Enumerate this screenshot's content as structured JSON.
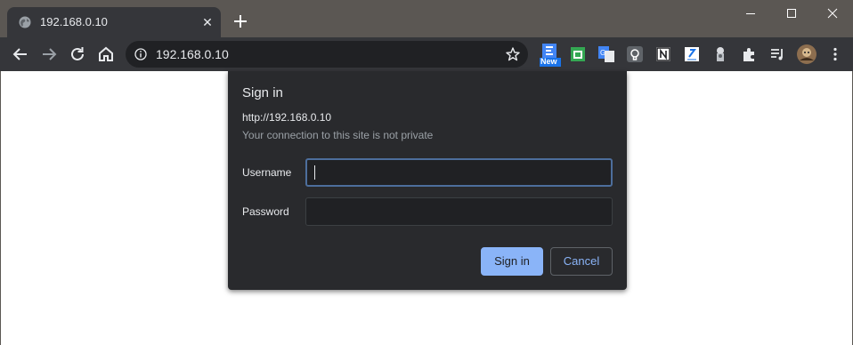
{
  "tab": {
    "title": "192.168.0.10",
    "favicon": "globe-icon",
    "close_glyph": "✕"
  },
  "window": {
    "controls": [
      "minimize-icon",
      "maximize-icon",
      "close-icon"
    ]
  },
  "toolbar": {
    "nav": [
      "back-icon",
      "forward-icon",
      "reload-icon",
      "home-icon"
    ],
    "address": "192.168.0.10",
    "extensions": [
      {
        "name": "new-extension-icon",
        "badge": "New"
      },
      {
        "name": "android-extension-icon"
      },
      {
        "name": "google-translate-icon"
      },
      {
        "name": "lightbulb-extension-icon"
      },
      {
        "name": "notion-icon"
      },
      {
        "name": "document-extension-icon"
      },
      {
        "name": "chef-extension-icon"
      },
      {
        "name": "puzzle-extensions-icon"
      },
      {
        "name": "media-queue-icon"
      },
      {
        "name": "profile-avatar"
      },
      {
        "name": "menu-kebab-icon"
      }
    ]
  },
  "dialog": {
    "title": "Sign in",
    "origin": "http://192.168.0.10",
    "warning": "Your connection to this site is not private",
    "username_label": "Username",
    "username_value": "",
    "password_label": "Password",
    "password_value": "",
    "sign_in_label": "Sign in",
    "cancel_label": "Cancel"
  },
  "colors": {
    "titlebar": "#5b5753",
    "toolbar": "#35363a",
    "dialog_bg": "#292a2d",
    "accent": "#8ab4f8"
  }
}
